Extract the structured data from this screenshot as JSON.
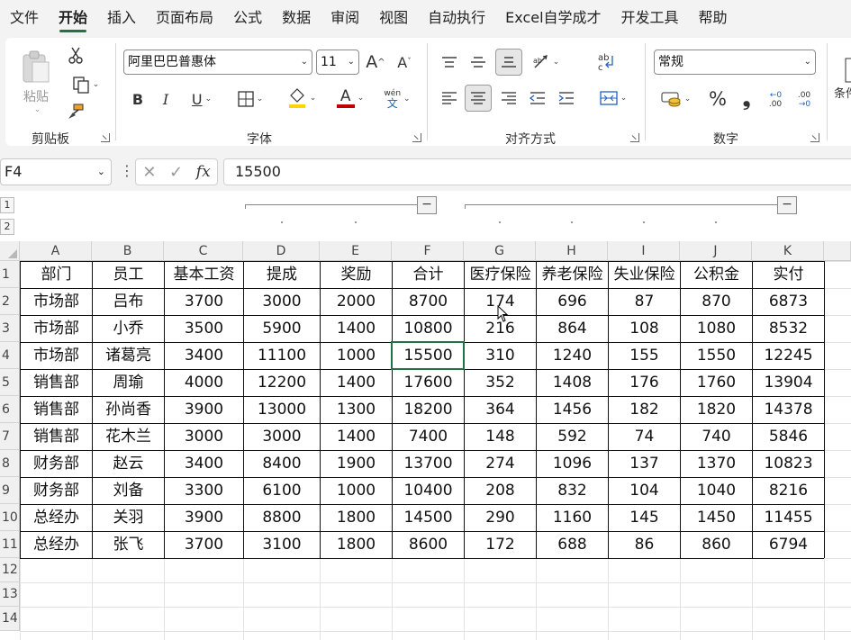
{
  "menu": {
    "items": [
      "文件",
      "开始",
      "插入",
      "页面布局",
      "公式",
      "数据",
      "审阅",
      "视图",
      "自动执行",
      "Excel自学成才",
      "开发工具",
      "帮助"
    ],
    "active_index": 1
  },
  "ribbon": {
    "clipboard": {
      "label": "剪贴板",
      "paste_label": "粘贴"
    },
    "font": {
      "label": "字体",
      "font_name": "阿里巴巴普惠体",
      "font_size": "11",
      "bold": "B",
      "italic": "I",
      "underline": "U",
      "phonetic_top": "wén",
      "phonetic_bottom": "文",
      "grow": "A",
      "shrink": "A",
      "font_color_glyph": "A"
    },
    "alignment": {
      "label": "对齐方式"
    },
    "number": {
      "label": "数字",
      "format": "常规",
      "percent": "%",
      "comma": "❟",
      "inc_decimal": ".00",
      "dec_decimal": ".00"
    },
    "styles": {
      "label_partial": "条件"
    },
    "colors": {
      "accent": "#217346",
      "fill_yellow": "#ffd400",
      "font_red": "#c00000"
    }
  },
  "formula_bar": {
    "name_box": "F4",
    "fx": "fx",
    "value": "15500"
  },
  "outline": {
    "levels": [
      "1",
      "2"
    ],
    "collapse": [
      "−",
      "−"
    ]
  },
  "sheet": {
    "columns": [
      "A",
      "B",
      "C",
      "D",
      "E",
      "F",
      "G",
      "H",
      "I",
      "J",
      "K"
    ],
    "row_numbers": [
      "1",
      "2",
      "3",
      "4",
      "5",
      "6",
      "7",
      "8",
      "9",
      "10",
      "11",
      "12",
      "13",
      "14"
    ],
    "rows": [
      [
        "部门",
        "员工",
        "基本工资",
        "提成",
        "奖励",
        "合计",
        "医疗保险",
        "养老保险",
        "失业保险",
        "公积金",
        "实付"
      ],
      [
        "市场部",
        "吕布",
        "3700",
        "3000",
        "2000",
        "8700",
        "174",
        "696",
        "87",
        "870",
        "6873"
      ],
      [
        "市场部",
        "小乔",
        "3500",
        "5900",
        "1400",
        "10800",
        "216",
        "864",
        "108",
        "1080",
        "8532"
      ],
      [
        "市场部",
        "诸葛亮",
        "3400",
        "11100",
        "1000",
        "15500",
        "310",
        "1240",
        "155",
        "1550",
        "12245"
      ],
      [
        "销售部",
        "周瑜",
        "4000",
        "12200",
        "1400",
        "17600",
        "352",
        "1408",
        "176",
        "1760",
        "13904"
      ],
      [
        "销售部",
        "孙尚香",
        "3900",
        "13000",
        "1300",
        "18200",
        "364",
        "1456",
        "182",
        "1820",
        "14378"
      ],
      [
        "销售部",
        "花木兰",
        "3000",
        "3000",
        "1400",
        "7400",
        "148",
        "592",
        "74",
        "740",
        "5846"
      ],
      [
        "财务部",
        "赵云",
        "3400",
        "8400",
        "1900",
        "13700",
        "274",
        "1096",
        "137",
        "1370",
        "10823"
      ],
      [
        "财务部",
        "刘备",
        "3300",
        "6100",
        "1000",
        "10400",
        "208",
        "832",
        "104",
        "1040",
        "8216"
      ],
      [
        "总经办",
        "关羽",
        "3900",
        "8800",
        "1800",
        "14500",
        "290",
        "1160",
        "145",
        "1450",
        "11455"
      ],
      [
        "总经办",
        "张飞",
        "3700",
        "3100",
        "1800",
        "8600",
        "172",
        "688",
        "86",
        "860",
        "6794"
      ]
    ]
  }
}
